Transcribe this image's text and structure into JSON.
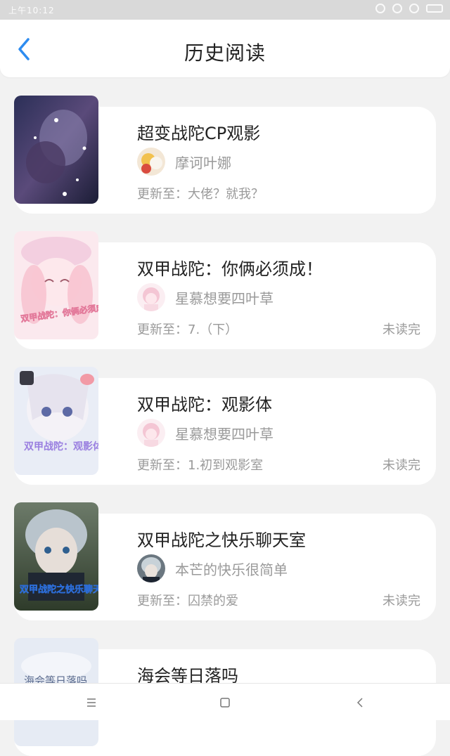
{
  "status_bar": {
    "time": "上午10:12"
  },
  "header": {
    "title": "历史阅读"
  },
  "books": [
    {
      "title": "超变战陀CP观影",
      "author": "摩诃叶娜",
      "update_prefix": "更新至：",
      "update": "大佬？就我？",
      "status": ""
    },
    {
      "title": "双甲战陀：你俩必须成！",
      "author": "星慕想要四叶草",
      "update_prefix": "更新至：",
      "update": "7.（下）",
      "status": "未读完",
      "cover_text": "双甲战陀：你俩必须成！"
    },
    {
      "title": "双甲战陀：观影体",
      "author": "星慕想要四叶草",
      "update_prefix": "更新至：",
      "update": "1.初到观影室",
      "status": "未读完",
      "cover_text": "双甲战陀：观影体"
    },
    {
      "title": "双甲战陀之快乐聊天室",
      "author": "本芒的快乐很简单",
      "update_prefix": "更新至：",
      "update": "囚禁的爱",
      "status": "未读完",
      "cover_text": "双甲战陀之快乐聊天室"
    },
    {
      "title": "海会等日落吗",
      "author": "",
      "update_prefix": "",
      "update": "",
      "status": "",
      "cover_text": "海会等日落吗"
    }
  ],
  "colors": {
    "accent": "#2d8cf0",
    "text": "#222222",
    "muted": "#9a9a9a",
    "background": "#f2f2f2"
  },
  "navigation": {
    "menu": "menu-icon",
    "home": "home-icon",
    "back": "back-icon"
  }
}
